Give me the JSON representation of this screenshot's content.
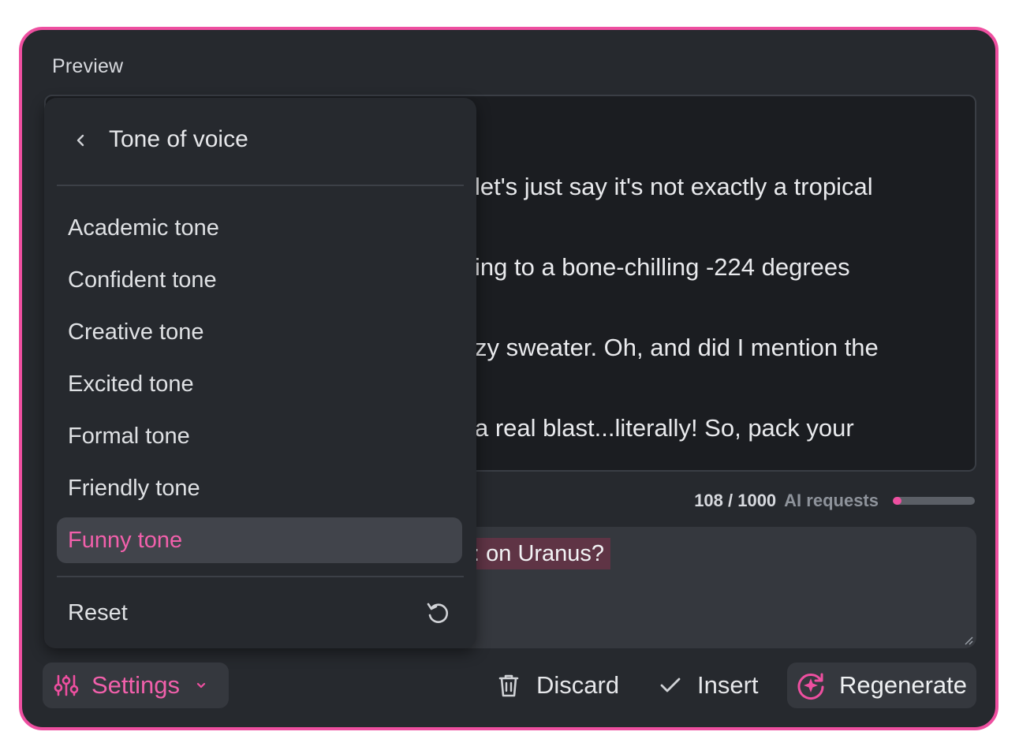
{
  "preview": {
    "label": "Preview",
    "lines": [
      "let's just say it's not exactly a tropical",
      "ing to a bone-chilling -224 degrees",
      "zy sweater. Oh, and did I mention the",
      "a real blast...literally! So, pack your"
    ]
  },
  "usage": {
    "count": "108 / 1000",
    "label": "AI requests",
    "fraction": 0.108
  },
  "prompt": {
    "text": "on Uranus?"
  },
  "tone_menu": {
    "title": "Tone of voice",
    "items": [
      "Academic tone",
      "Confident tone",
      "Creative tone",
      "Excited tone",
      "Formal tone",
      "Friendly tone",
      "Funny tone"
    ],
    "selected": "Funny tone",
    "reset_label": "Reset"
  },
  "footer": {
    "settings_label": "Settings",
    "discard_label": "Discard",
    "insert_label": "Insert",
    "regenerate_label": "Regenerate"
  },
  "colors": {
    "accent": "#ee4fa0",
    "panel_bg": "#26292e",
    "highlight_bg": "#5f3445"
  },
  "icons": {
    "back": "chevron-left-icon",
    "reset": "undo-icon",
    "settings": "sliders-icon",
    "settings_chevron": "chevron-down-icon",
    "discard": "trash-icon",
    "insert": "check-icon",
    "regenerate": "sparkle-refresh-icon"
  }
}
